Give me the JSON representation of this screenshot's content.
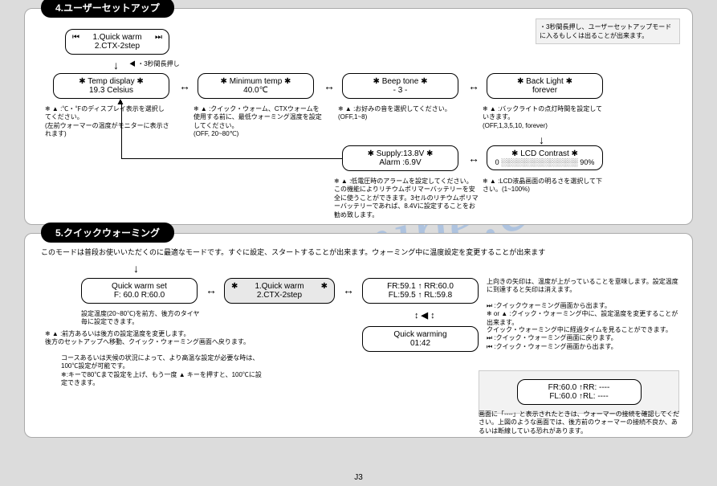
{
  "watermark": "manualsmine.com",
  "page_number": "J3",
  "section4": {
    "title": "4.ユーザーセットアップ",
    "top_note": "・3秒間長押し、ユーザーセットアップモードに入るもしくは出ることが出来ます。",
    "menu_box": {
      "line1": "1.Quick warm",
      "line2": "2.CTX-2step",
      "left_icon": "⏮",
      "right_icon": "⏭"
    },
    "hold_label": "◀ ・3秒間長押し",
    "temp_display": {
      "header": "✱   Temp display   ✱",
      "value": "19.3 Celsius"
    },
    "temp_display_desc": "❄ ▲ :℃・℉のディスプレイ表示を選択してください。\n(左前ウォーマーの温度がモニターに表示されます)",
    "min_temp": {
      "header": "✱   Minimum temp   ✱",
      "value": "40.0℃"
    },
    "min_temp_desc": "❄ ▲ :クイック・ウォーム、CTXウォームを使用する前に、最低ウォーミング温度を設定してください。\n(OFF, 20~80℃)",
    "beep": {
      "header": "✱     Beep tone     ✱",
      "value": "- 3 -"
    },
    "beep_desc": "❄ ▲ :お好みの音を選択してください。\n(OFF,1~8)",
    "backlight": {
      "header": "✱    Back Light    ✱",
      "value": "forever"
    },
    "backlight_desc": "❄ ▲ :バックライトの点灯時間を設定していきます。\n(OFF,1,3,5,10, forever)",
    "lcd": {
      "header": "✱   LCD Contrast   ✱",
      "bar": "0 ░░░░░░░░░░░░░░░ 90%"
    },
    "lcd_desc": "❄ ▲ :LCD液晶画面の明るさを選択して下さい。(1~100%)",
    "supply": {
      "line1": "✱   Supply:13.8V   ✱",
      "line2": "Alarm :6.9V"
    },
    "supply_desc": "❄ ▲ :低電圧時のアラームを設定してください。この機能によりリチウムポリマーバッテリーを安全に使うことができます。3セルのリチウムポリマーバッテリーであれば、8.4Vに設定することをお勧め致します。"
  },
  "section5": {
    "title": "5.クイックウォーミング",
    "intro": "このモードは普段お使いいただくのに最適なモードです。すぐに設定、スタートすることが出来ます。ウォーミング中に温度設定を変更することが出来ます",
    "qw_set": {
      "header": "Quick warm set",
      "line2": "F: 60.0    R:60.0"
    },
    "qw_set_desc1": "設定温度(20~80℃)を前方、後方のタイヤ毎に設定できます。",
    "qw_set_desc2": "❄ ▲ :前方あるいは後方の設定温度を変更します。\n後方のセットアップへ移動、クイック・ウォーミング画面へ戻ります。",
    "qw_set_desc3": "コースあるいは天候の状況によって、より高温な設定が必要な時は、100℃設定が可能です。\n❄:キーで80℃まで設定を上げ、もう一度 ▲ キーを押すと、100℃に設定できます。",
    "menu_box": {
      "line1": "1.Quick warm",
      "line2": "2.CTX-2step",
      "left_icon": "✱",
      "right_icon": "✱"
    },
    "temps": {
      "line1": "FR:59.1 ↑  RR:60.0",
      "line2": "FL:59.5 ↑ RL:59.8"
    },
    "temps_desc1": "上向きの矢印は、温度が上がっていることを意味します。設定温度に到達すると矢印は消えます。",
    "temps_desc2": "⏭ :クイックウォーミング画面から出ます。\n❄ or ▲ :クイック・ウォーミング中に、設定温度を変更することが出来ます。",
    "timer": {
      "line1": "Quick warming",
      "line2": "01:42"
    },
    "timer_desc": "クイック・ウォーミング中に経過タイムを見ることができます。\n⏭ :クイック・ウォーミング画面に戻ります。\n⏮ :クイック・ウォーミング画面から出ます。",
    "err_box": {
      "line1": "FR:60.0  ↑RR: ----",
      "line2": "FL:60.0  ↑RL: ----"
    },
    "err_desc": "画面に「----」と表示されたときは、ウォーマーの接続を確認してください。上図のような画面では、後方前のウォーマーの接続不良か、あるいは断線している恐れがあります。"
  }
}
